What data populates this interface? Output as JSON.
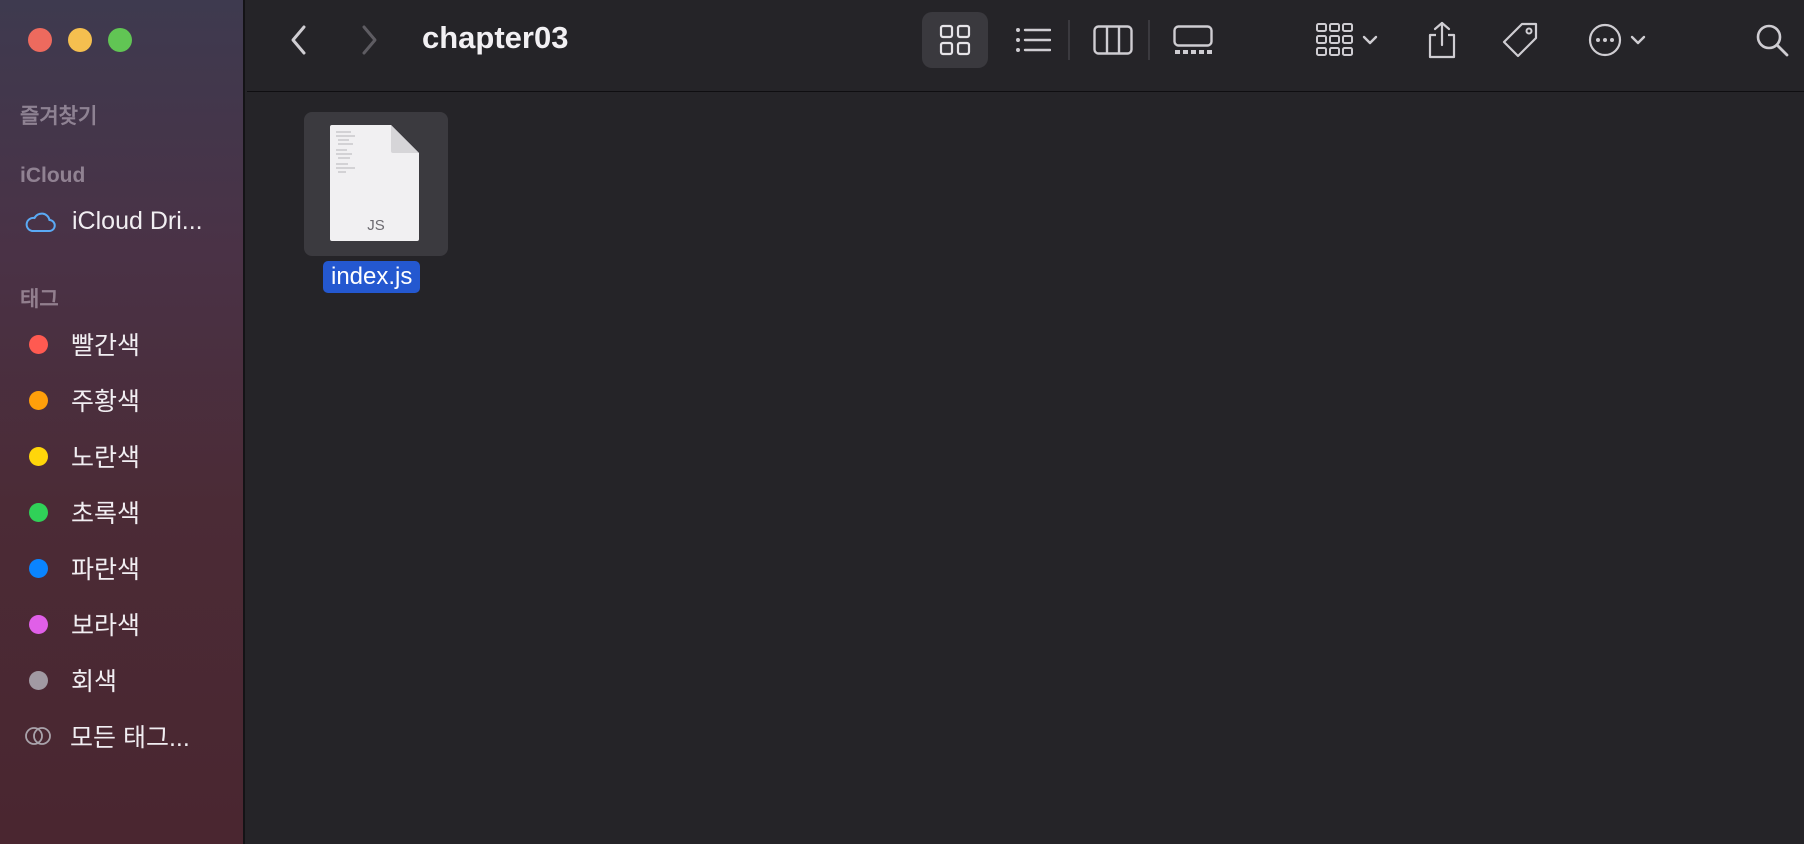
{
  "window": {
    "title": "chapter03",
    "traffic_colors": {
      "close": "#ed6a5e",
      "minimize": "#f5bf4f",
      "zoom": "#61c554"
    }
  },
  "sidebar": {
    "favorites_title": "즐겨찾기",
    "icloud_title": "iCloud",
    "icloud_item": {
      "label": "iCloud Dri...",
      "icon": "cloud-icon"
    },
    "tags_title": "태그",
    "tags": [
      {
        "label": "빨간색",
        "color": "#ff5a51"
      },
      {
        "label": "주황색",
        "color": "#ff9f0a"
      },
      {
        "label": "노란색",
        "color": "#ffd60a"
      },
      {
        "label": "초록색",
        "color": "#30d158"
      },
      {
        "label": "파란색",
        "color": "#0a84ff"
      },
      {
        "label": "보라색",
        "color": "#e05fe8"
      },
      {
        "label": "회색",
        "color": "#a19aa3"
      }
    ],
    "all_tags": {
      "label": "모든 태그...",
      "icon": "all-tags-icon"
    }
  },
  "toolbar": {
    "back": "chevron-left-icon",
    "forward": "chevron-right-icon",
    "views": [
      "icon-view-icon",
      "list-view-icon",
      "column-view-icon",
      "gallery-view-icon"
    ],
    "active_view": "icon-view-icon",
    "group": "group-icon",
    "share": "share-icon",
    "tag": "tag-icon",
    "more": "more-icon",
    "search": "search-icon"
  },
  "files": [
    {
      "name": "index.js",
      "badge": "JS",
      "selected": true
    }
  ]
}
